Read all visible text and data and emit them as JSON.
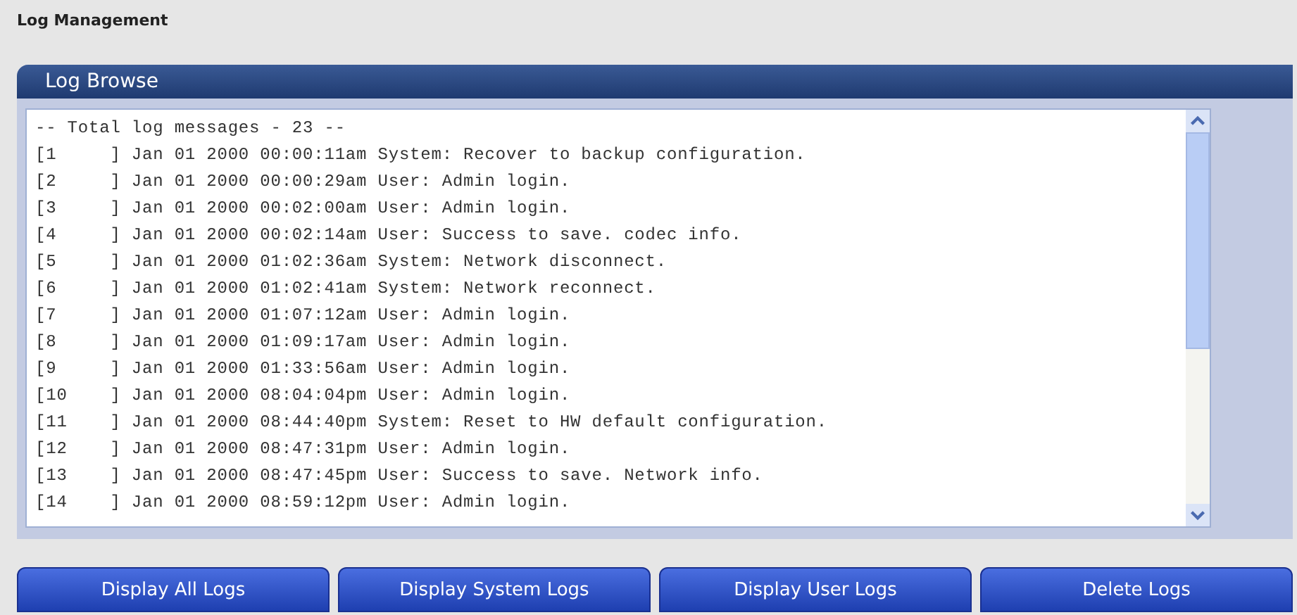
{
  "page_title": "Log Management",
  "panel": {
    "title": "Log Browse",
    "log_lines": [
      "-- Total log messages - 23 --",
      "[1     ] Jan 01 2000 00:00:11am System: Recover to backup configuration.",
      "[2     ] Jan 01 2000 00:00:29am User: Admin login.",
      "[3     ] Jan 01 2000 00:02:00am User: Admin login.",
      "[4     ] Jan 01 2000 00:02:14am User: Success to save. codec info.",
      "[5     ] Jan 01 2000 01:02:36am System: Network disconnect.",
      "[6     ] Jan 01 2000 01:02:41am System: Network reconnect.",
      "[7     ] Jan 01 2000 01:07:12am User: Admin login.",
      "[8     ] Jan 01 2000 01:09:17am User: Admin login.",
      "[9     ] Jan 01 2000 01:33:56am User: Admin login.",
      "[10    ] Jan 01 2000 08:04:04pm User: Admin login.",
      "[11    ] Jan 01 2000 08:44:40pm System: Reset to HW default configuration.",
      "[12    ] Jan 01 2000 08:47:31pm User: Admin login.",
      "[13    ] Jan 01 2000 08:47:45pm User: Success to save. Network info.",
      "[14    ] Jan 01 2000 08:59:12pm User: Admin login."
    ]
  },
  "buttons": [
    "Display All Logs",
    "Display System Logs",
    "Display User Logs",
    "Delete Logs"
  ]
}
